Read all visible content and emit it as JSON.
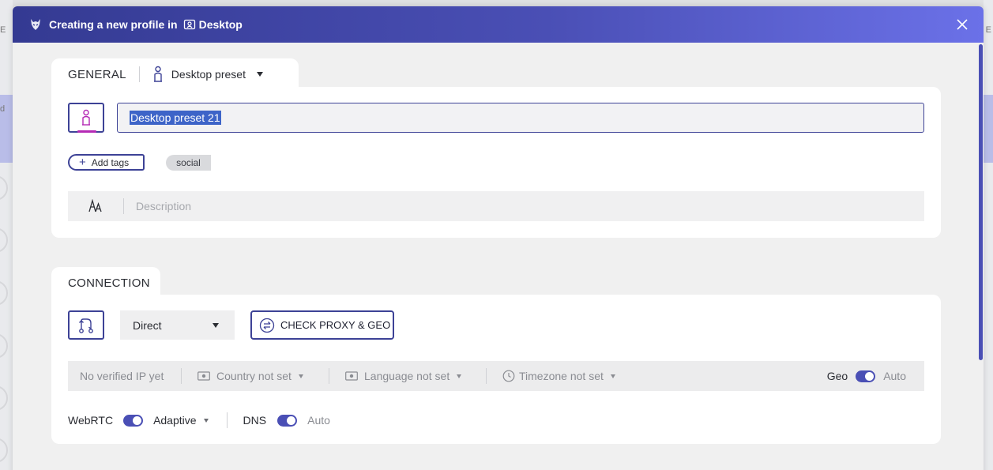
{
  "header": {
    "title": "Creating a new profile in",
    "workspace": "Desktop",
    "close_icon": "close-icon"
  },
  "general": {
    "tab_label": "GENERAL",
    "preset_label": "Desktop preset",
    "profile_name": "Desktop preset 21",
    "add_tags_label": "Add tags",
    "tags": [
      "social"
    ],
    "description_placeholder": "Description",
    "description_icon": "AA"
  },
  "connection": {
    "tab_label": "CONNECTION",
    "type_value": "Direct",
    "check_button": "CHECK PROXY & GEO",
    "ip_status": "No verified IP yet",
    "country": "Country not set",
    "language": "Language not set",
    "timezone": "Timezone not set",
    "geo_label": "Geo",
    "geo_mode": "Auto",
    "webrtc_label": "WebRTC",
    "webrtc_mode": "Adaptive",
    "dns_label": "DNS",
    "dns_mode": "Auto"
  },
  "background": {
    "left_glyph_1": "E",
    "left_glyph_2": "d",
    "right_glyph": "E"
  },
  "colors": {
    "accent": "#3d4296",
    "header_start": "#343a92",
    "header_end": "#6b71e8",
    "avatar_accent": "#b52ab5"
  }
}
